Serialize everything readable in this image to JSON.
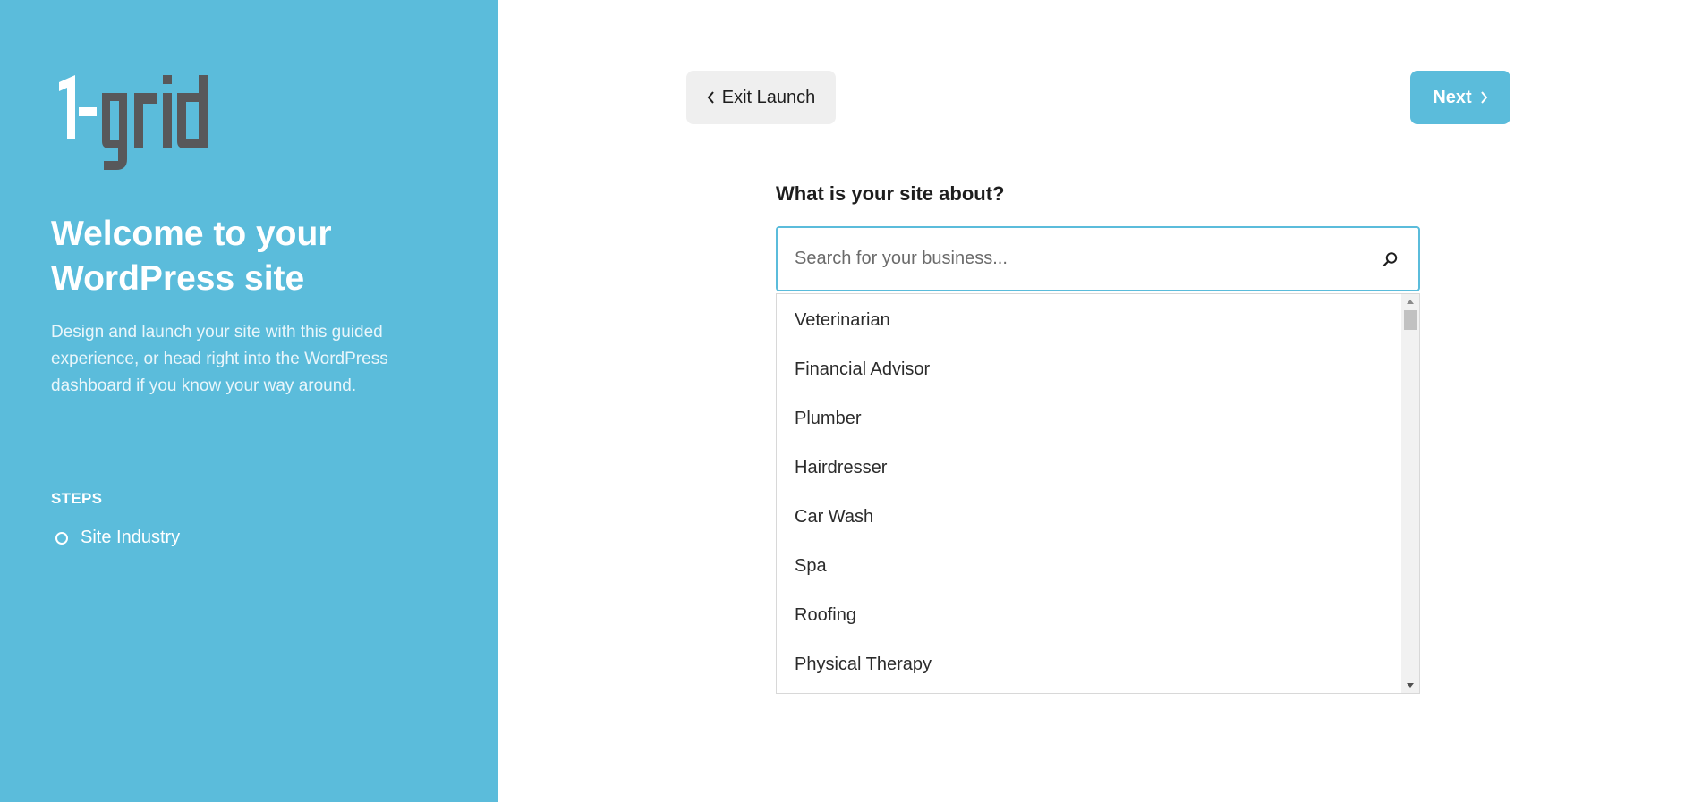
{
  "sidebar": {
    "logo_text": "1-grid",
    "welcome_title": "Welcome to your WordPress site",
    "intro": "Design and launch your site with this guided experience, or head right into the WordPress dashboard if you know your way around.",
    "steps_heading": "STEPS",
    "steps": [
      {
        "label": "Site Industry",
        "icon": "circle-outline-icon"
      }
    ]
  },
  "header": {
    "exit_label": "Exit Launch",
    "exit_icon": "chevron-left-icon",
    "next_label": "Next",
    "next_icon": "chevron-right-icon"
  },
  "main": {
    "question": "What is your site about?",
    "search": {
      "placeholder": "Search for your business...",
      "value": "",
      "icon": "search-icon"
    },
    "options": [
      "Veterinarian",
      "Financial Advisor",
      "Plumber",
      "Hairdresser",
      "Car Wash",
      "Spa",
      "Roofing",
      "Physical Therapy"
    ]
  },
  "colors": {
    "accent": "#5bbcdb",
    "logo_dark": "#58585a",
    "button_secondary_bg": "#efefef"
  }
}
